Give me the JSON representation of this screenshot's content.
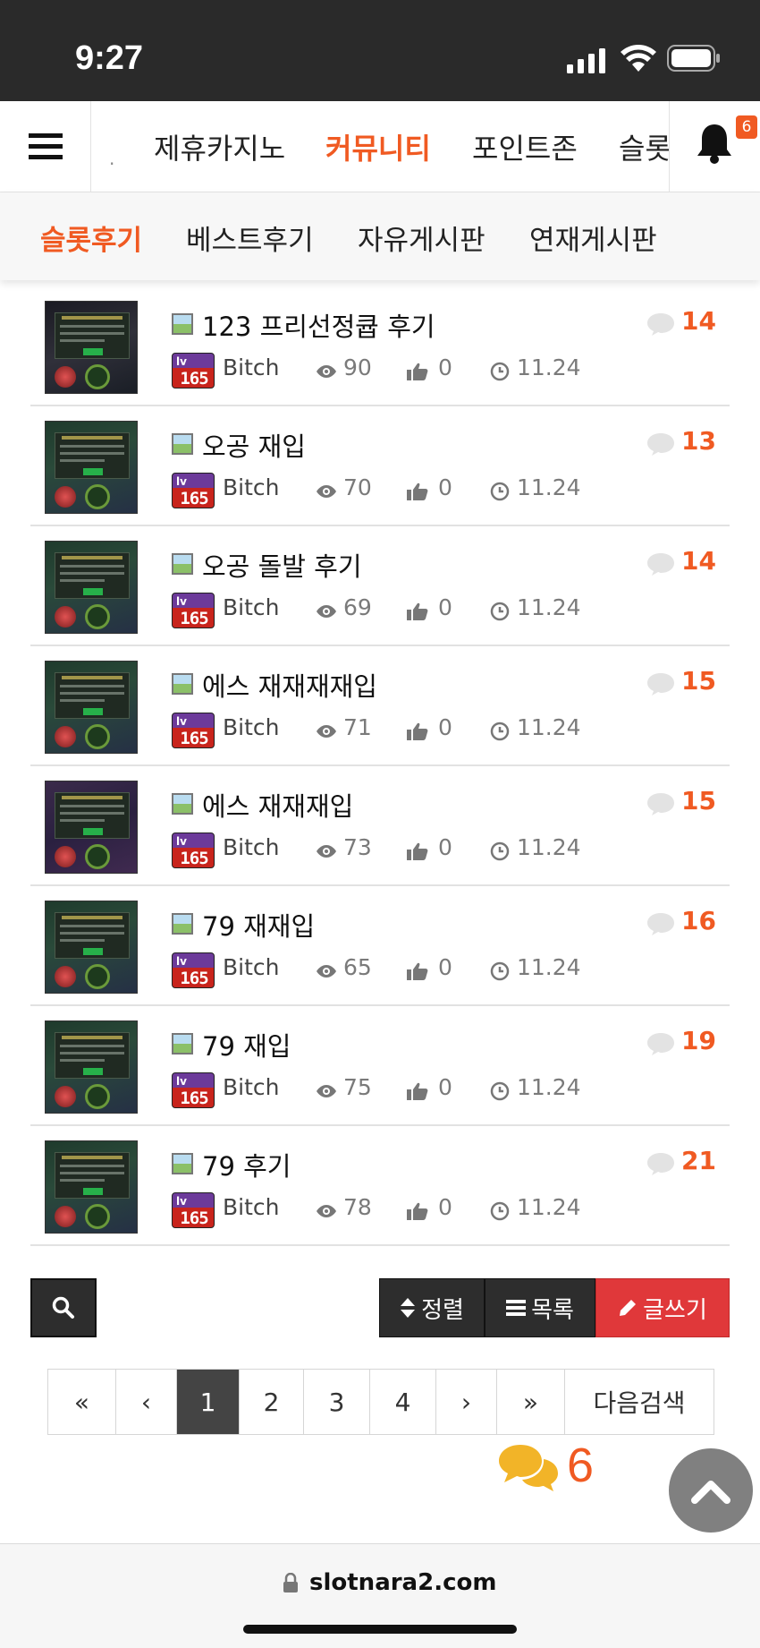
{
  "status": {
    "time": "9:27"
  },
  "topnav": {
    "tabs": [
      "제휴카지노",
      "커뮤니티",
      "포인트존",
      "슬롯"
    ],
    "active_tab": "커뮤니티",
    "notification_count": "6"
  },
  "subnav": {
    "items": [
      "슬롯후기",
      "베스트후기",
      "자유게시판",
      "연재게시판"
    ],
    "active": "슬롯후기"
  },
  "posts": [
    {
      "title": "123 프리선정큡 후기",
      "level": "165",
      "author": "Bitch",
      "views": "90",
      "likes": "0",
      "date": "11.24",
      "comments": "14"
    },
    {
      "title": "오공 재입",
      "level": "165",
      "author": "Bitch",
      "views": "70",
      "likes": "0",
      "date": "11.24",
      "comments": "13"
    },
    {
      "title": "오공 돌발 후기",
      "level": "165",
      "author": "Bitch",
      "views": "69",
      "likes": "0",
      "date": "11.24",
      "comments": "14"
    },
    {
      "title": "에스 재재재재입",
      "level": "165",
      "author": "Bitch",
      "views": "71",
      "likes": "0",
      "date": "11.24",
      "comments": "15"
    },
    {
      "title": "에스 재재재입",
      "level": "165",
      "author": "Bitch",
      "views": "73",
      "likes": "0",
      "date": "11.24",
      "comments": "15"
    },
    {
      "title": "79 재재입",
      "level": "165",
      "author": "Bitch",
      "views": "65",
      "likes": "0",
      "date": "11.24",
      "comments": "16"
    },
    {
      "title": "79 재입",
      "level": "165",
      "author": "Bitch",
      "views": "75",
      "likes": "0",
      "date": "11.24",
      "comments": "19"
    },
    {
      "title": "79 후기",
      "level": "165",
      "author": "Bitch",
      "views": "78",
      "likes": "0",
      "date": "11.24",
      "comments": "21"
    }
  ],
  "actions": {
    "sort_label": "정렬",
    "list_label": "목록",
    "write_label": "글쓰기"
  },
  "pagination": {
    "first": "«",
    "prev": "‹",
    "pages": [
      "1",
      "2",
      "3",
      "4"
    ],
    "current": "1",
    "next": "›",
    "last": "»",
    "next_search": "다음검색"
  },
  "chat": {
    "count": "6"
  },
  "browser": {
    "url": "slotnara2.com"
  },
  "colors": {
    "accent": "#f05a22",
    "write_button": "#e0383a",
    "dark_button": "#2d2d2d"
  }
}
